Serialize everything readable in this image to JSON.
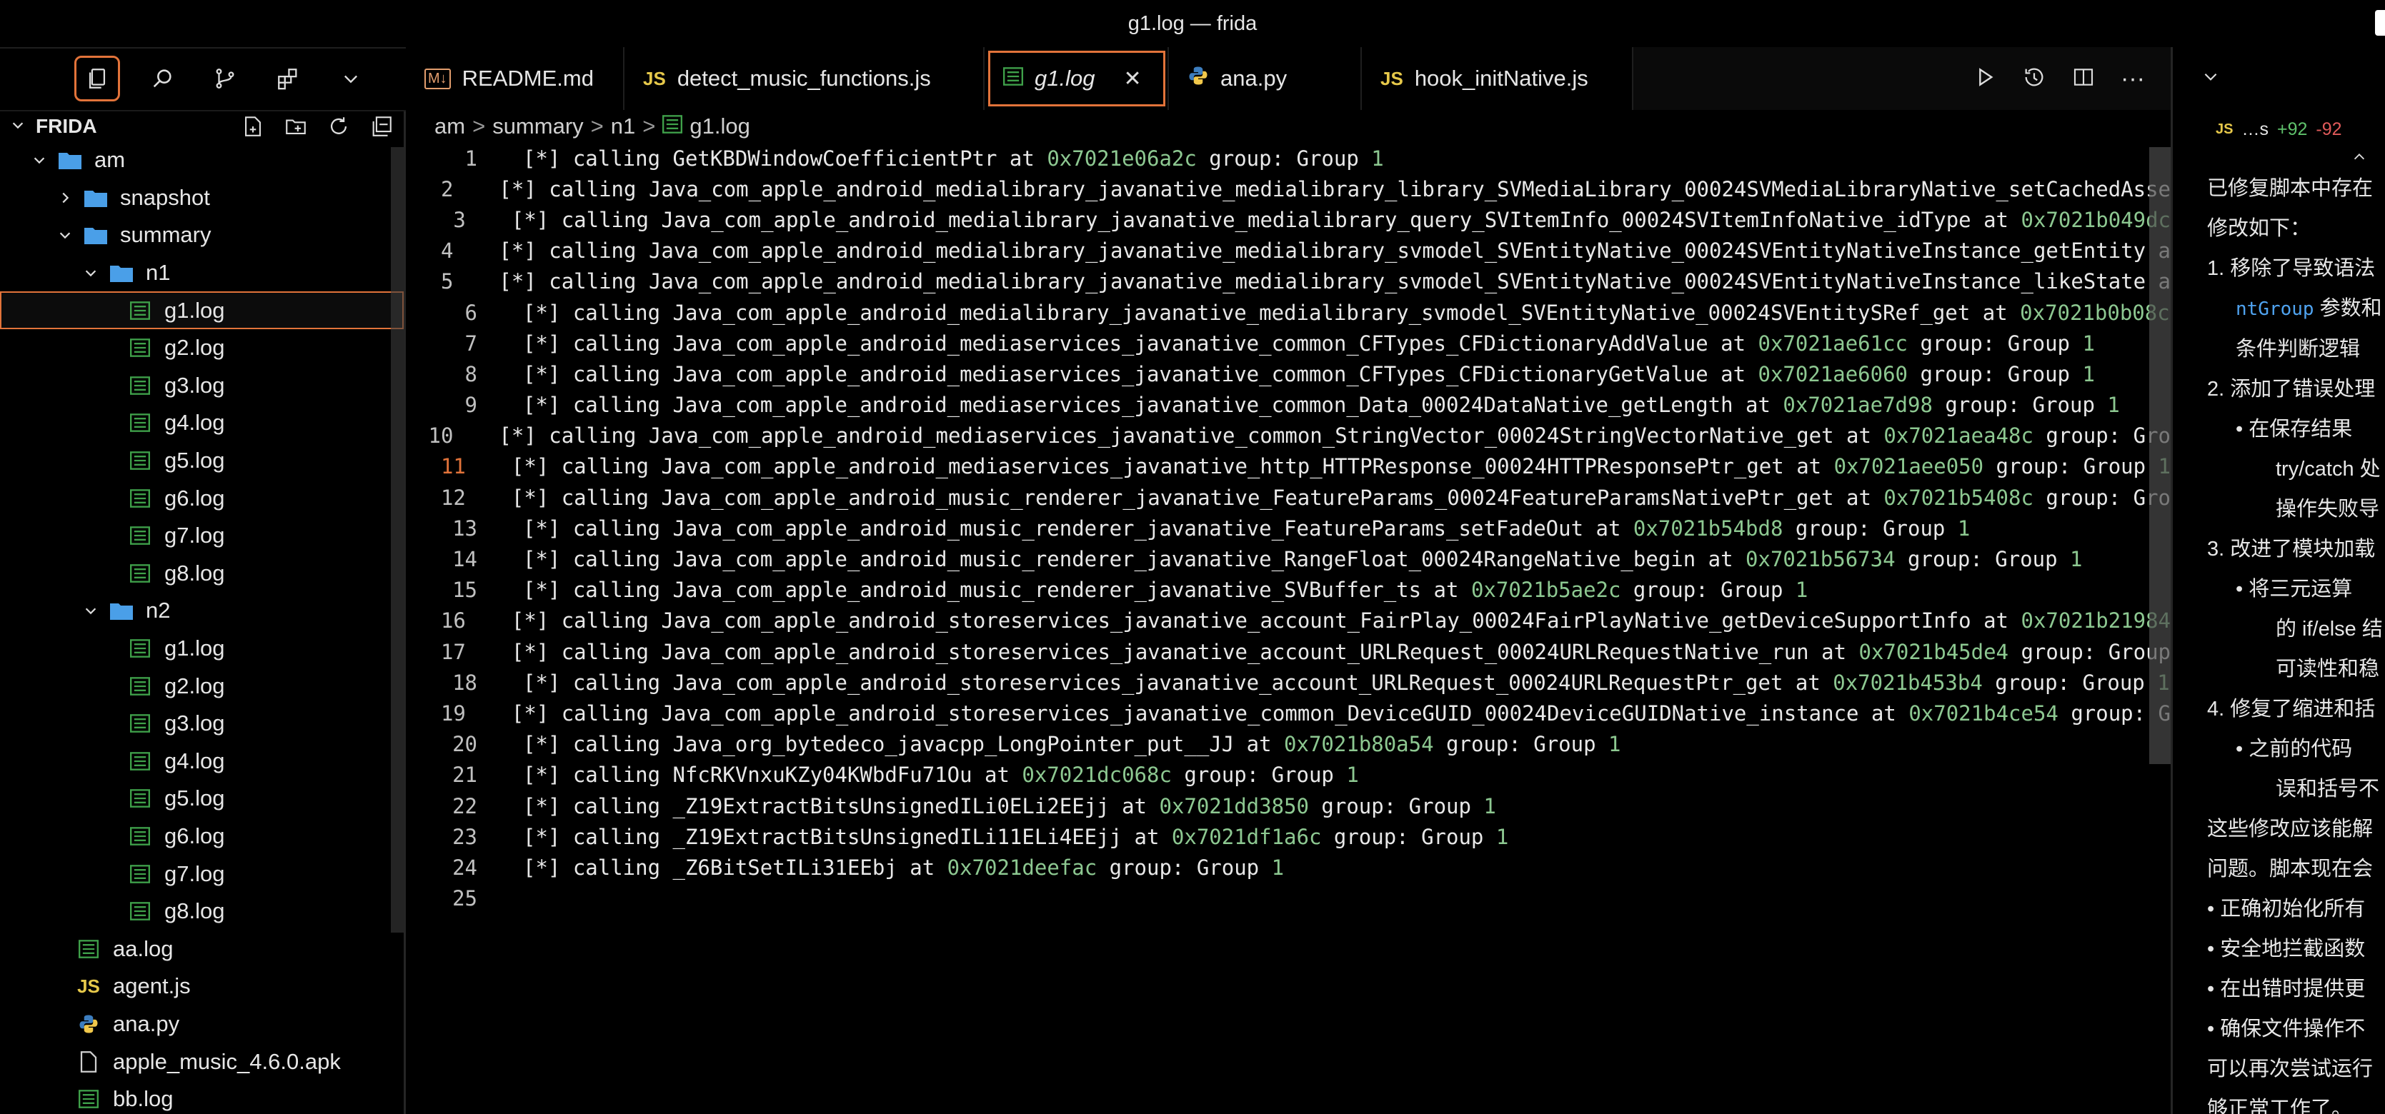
{
  "window": {
    "title": "g1.log — frida"
  },
  "sidebar": {
    "toolbar_icons": [
      "explorer-icon",
      "search-icon",
      "source-control-icon",
      "extensions-icon",
      "chevron-down-icon"
    ],
    "root_label": "FRIDA",
    "header_actions": [
      "new-file-icon",
      "new-folder-icon",
      "refresh-icon",
      "collapse-all-icon"
    ],
    "tree": [
      {
        "label": "am",
        "kind": "folder",
        "depth": 0,
        "open": true
      },
      {
        "label": "snapshot",
        "kind": "folder",
        "depth": 1,
        "open": false
      },
      {
        "label": "summary",
        "kind": "folder",
        "depth": 1,
        "open": true
      },
      {
        "label": "n1",
        "kind": "folder",
        "depth": 2,
        "open": true
      },
      {
        "label": "g1.log",
        "kind": "log",
        "depth": 3,
        "selected": true
      },
      {
        "label": "g2.log",
        "kind": "log",
        "depth": 3
      },
      {
        "label": "g3.log",
        "kind": "log",
        "depth": 3
      },
      {
        "label": "g4.log",
        "kind": "log",
        "depth": 3
      },
      {
        "label": "g5.log",
        "kind": "log",
        "depth": 3
      },
      {
        "label": "g6.log",
        "kind": "log",
        "depth": 3
      },
      {
        "label": "g7.log",
        "kind": "log",
        "depth": 3
      },
      {
        "label": "g8.log",
        "kind": "log",
        "depth": 3
      },
      {
        "label": "n2",
        "kind": "folder",
        "depth": 2,
        "open": true
      },
      {
        "label": "g1.log",
        "kind": "log",
        "depth": 3
      },
      {
        "label": "g2.log",
        "kind": "log",
        "depth": 3
      },
      {
        "label": "g3.log",
        "kind": "log",
        "depth": 3
      },
      {
        "label": "g4.log",
        "kind": "log",
        "depth": 3
      },
      {
        "label": "g5.log",
        "kind": "log",
        "depth": 3
      },
      {
        "label": "g6.log",
        "kind": "log",
        "depth": 3
      },
      {
        "label": "g7.log",
        "kind": "log",
        "depth": 3
      },
      {
        "label": "g8.log",
        "kind": "log",
        "depth": 3
      },
      {
        "label": "aa.log",
        "kind": "log",
        "depth": 1
      },
      {
        "label": "agent.js",
        "kind": "js",
        "depth": 1
      },
      {
        "label": "ana.py",
        "kind": "py",
        "depth": 1
      },
      {
        "label": "apple_music_4.6.0.apk",
        "kind": "file",
        "depth": 1
      },
      {
        "label": "bb.log",
        "kind": "log",
        "depth": 1
      }
    ]
  },
  "tabs": [
    {
      "label": "README.md",
      "kind": "md",
      "badge": "M↓"
    },
    {
      "label": "detect_music_functions.js",
      "kind": "js",
      "badge": "JS"
    },
    {
      "label": "g1.log",
      "kind": "log",
      "active": true,
      "close": "✕"
    },
    {
      "label": "ana.py",
      "kind": "py"
    },
    {
      "label": "hook_initNative.js",
      "kind": "js",
      "badge": "JS"
    }
  ],
  "breadcrumb": [
    "am",
    "summary",
    "n1",
    "g1.log"
  ],
  "breadcrumb_sep": ">",
  "editor": {
    "current_line": 11,
    "lines": [
      {
        "n": "1",
        "prefix": "[*] calling ",
        "fn": "GetKBDWindowCoefficientPtr",
        "at": " at ",
        "addr": "0x7021e06a2c",
        "group": " group: Group ",
        "g": "1"
      },
      {
        "n": "2",
        "prefix": "[*] calling ",
        "fn": "Java_com_apple_android_medialibrary_javanative_medialibrary_library_SVMediaLibrary_00024SVMediaLibraryNative_setCachedAsse",
        "at": "",
        "addr": "",
        "group": "",
        "g": ""
      },
      {
        "n": "3",
        "prefix": "[*] calling ",
        "fn": "Java_com_apple_android_medialibrary_javanative_medialibrary_query_SVItemInfo_00024SVItemInfoNative_idType",
        "at": " at ",
        "addr": "0x7021b049dc",
        "group": "",
        "g": ""
      },
      {
        "n": "4",
        "prefix": "[*] calling ",
        "fn": "Java_com_apple_android_medialibrary_javanative_medialibrary_svmodel_SVEntityNative_00024SVEntityNativeInstance_getEntity a",
        "at": "",
        "addr": "",
        "group": "",
        "g": ""
      },
      {
        "n": "5",
        "prefix": "[*] calling ",
        "fn": "Java_com_apple_android_medialibrary_javanative_medialibrary_svmodel_SVEntityNative_00024SVEntityNativeInstance_likeState a",
        "at": "",
        "addr": "",
        "group": "",
        "g": ""
      },
      {
        "n": "6",
        "prefix": "[*] calling ",
        "fn": "Java_com_apple_android_medialibrary_javanative_medialibrary_svmodel_SVEntityNative_00024SVEntitySRef_get",
        "at": " at ",
        "addr": "0x7021b0b08c",
        "group": "",
        "g": ""
      },
      {
        "n": "7",
        "prefix": "[*] calling ",
        "fn": "Java_com_apple_android_mediaservices_javanative_common_CFTypes_CFDictionaryAddValue",
        "at": " at ",
        "addr": "0x7021ae61cc",
        "group": " group: Group ",
        "g": "1"
      },
      {
        "n": "8",
        "prefix": "[*] calling ",
        "fn": "Java_com_apple_android_mediaservices_javanative_common_CFTypes_CFDictionaryGetValue",
        "at": " at ",
        "addr": "0x7021ae6060",
        "group": " group: Group ",
        "g": "1"
      },
      {
        "n": "9",
        "prefix": "[*] calling ",
        "fn": "Java_com_apple_android_mediaservices_javanative_common_Data_00024DataNative_getLength",
        "at": " at ",
        "addr": "0x7021ae7d98",
        "group": " group: Group ",
        "g": "1"
      },
      {
        "n": "10",
        "prefix": "[*] calling ",
        "fn": "Java_com_apple_android_mediaservices_javanative_common_StringVector_00024StringVectorNative_get",
        "at": " at ",
        "addr": "0x7021aea48c",
        "group": " group: Gro",
        "g": ""
      },
      {
        "n": "11",
        "prefix": "[*] calling ",
        "fn": "Java_com_apple_android_mediaservices_javanative_http_HTTPResponse_00024HTTPResponsePtr_get",
        "at": " at ",
        "addr": "0x7021aee050",
        "group": " group: Group ",
        "g": "1"
      },
      {
        "n": "12",
        "prefix": "[*] calling ",
        "fn": "Java_com_apple_android_music_renderer_javanative_FeatureParams_00024FeatureParamsNativePtr_get",
        "at": " at ",
        "addr": "0x7021b5408c",
        "group": " group: Gro",
        "g": ""
      },
      {
        "n": "13",
        "prefix": "[*] calling ",
        "fn": "Java_com_apple_android_music_renderer_javanative_FeatureParams_setFadeOut",
        "at": " at ",
        "addr": "0x7021b54bd8",
        "group": " group: Group ",
        "g": "1"
      },
      {
        "n": "14",
        "prefix": "[*] calling ",
        "fn": "Java_com_apple_android_music_renderer_javanative_RangeFloat_00024RangeNative_begin",
        "at": " at ",
        "addr": "0x7021b56734",
        "group": " group: Group ",
        "g": "1"
      },
      {
        "n": "15",
        "prefix": "[*] calling ",
        "fn": "Java_com_apple_android_music_renderer_javanative_SVBuffer_ts",
        "at": " at ",
        "addr": "0x7021b5ae2c",
        "group": " group: Group ",
        "g": "1"
      },
      {
        "n": "16",
        "prefix": "[*] calling ",
        "fn": "Java_com_apple_android_storeservices_javanative_account_FairPlay_00024FairPlayNative_getDeviceSupportInfo",
        "at": " at ",
        "addr": "0x7021b21984",
        "group": "",
        "g": ""
      },
      {
        "n": "17",
        "prefix": "[*] calling ",
        "fn": "Java_com_apple_android_storeservices_javanative_account_URLRequest_00024URLRequestNative_run",
        "at": " at ",
        "addr": "0x7021b45de4",
        "group": " group: Group",
        "g": ""
      },
      {
        "n": "18",
        "prefix": "[*] calling ",
        "fn": "Java_com_apple_android_storeservices_javanative_account_URLRequest_00024URLRequestPtr_get",
        "at": " at ",
        "addr": "0x7021b453b4",
        "group": " group: Group ",
        "g": "1"
      },
      {
        "n": "19",
        "prefix": "[*] calling ",
        "fn": "Java_com_apple_android_storeservices_javanative_common_DeviceGUID_00024DeviceGUIDNative_instance",
        "at": " at ",
        "addr": "0x7021b4ce54",
        "group": " group: G",
        "g": ""
      },
      {
        "n": "20",
        "prefix": "[*] calling ",
        "fn": "Java_org_bytedeco_javacpp_LongPointer_put__JJ",
        "at": " at ",
        "addr": "0x7021b80a54",
        "group": " group: Group ",
        "g": "1"
      },
      {
        "n": "21",
        "prefix": "[*] calling ",
        "fn": "NfcRKVnxuKZy04KWbdFu71Ou",
        "at": " at ",
        "addr": "0x7021dc068c",
        "group": " group: Group ",
        "g": "1"
      },
      {
        "n": "22",
        "prefix": "[*] calling ",
        "fn": "_Z19ExtractBitsUnsignedILi0ELi2EEjj",
        "at": " at ",
        "addr": "0x7021dd3850",
        "group": " group: Group ",
        "g": "1"
      },
      {
        "n": "23",
        "prefix": "[*] calling ",
        "fn": "_Z19ExtractBitsUnsignedILi11ELi4EEjj",
        "at": " at ",
        "addr": "0x7021df1a6c",
        "group": " group: Group ",
        "g": "1"
      },
      {
        "n": "24",
        "prefix": "[*] calling ",
        "fn": "_Z6BitSetILi31EEbj",
        "at": " at ",
        "addr": "0x7021deefac",
        "group": " group: Group ",
        "g": "1"
      },
      {
        "n": "25",
        "prefix": "",
        "fn": "",
        "at": "",
        "addr": "",
        "group": "",
        "g": ""
      }
    ]
  },
  "right_panel": {
    "file_badge": "JS",
    "file_name": "…s",
    "added": "+92",
    "removed": "-92",
    "lines": [
      {
        "text": "已修复脚本中存在",
        "cls": ""
      },
      {
        "text": "修改如下：",
        "cls": ""
      },
      {
        "text": "1. 移除了导致语法",
        "cls": ""
      },
      {
        "text": "ntGroup 参数和",
        "cls": "sub",
        "code": "ntGroup"
      },
      {
        "text": "条件判断逻辑",
        "cls": "sub"
      },
      {
        "text": "2. 添加了错误处理",
        "cls": ""
      },
      {
        "text": "• 在保存结果",
        "cls": "sub"
      },
      {
        "text": "try/catch 处",
        "cls": "sub2"
      },
      {
        "text": "操作失败导",
        "cls": "sub2"
      },
      {
        "text": "3. 改进了模块加载",
        "cls": ""
      },
      {
        "text": "• 将三元运算",
        "cls": "sub"
      },
      {
        "text": "的 if/else 结",
        "cls": "sub2"
      },
      {
        "text": "可读性和稳",
        "cls": "sub2"
      },
      {
        "text": "4. 修复了缩进和括",
        "cls": ""
      },
      {
        "text": "• 之前的代码",
        "cls": "sub"
      },
      {
        "text": "误和括号不",
        "cls": "sub2"
      },
      {
        "text": "这些修改应该能解",
        "cls": ""
      },
      {
        "text": "问题。脚本现在会",
        "cls": ""
      },
      {
        "text": "• 正确初始化所有",
        "cls": ""
      },
      {
        "text": "• 安全地拦截函数",
        "cls": ""
      },
      {
        "text": "• 在出错时提供更",
        "cls": ""
      },
      {
        "text": "• 确保文件操作不",
        "cls": ""
      },
      {
        "text": "可以再次尝试运行",
        "cls": ""
      },
      {
        "text": "够正常工作了。",
        "cls": ""
      }
    ]
  },
  "colors": {
    "accent": "#e2733a",
    "address": "#8dc891",
    "folder": "#4a9fe8",
    "log_icon": "#3fa14a"
  }
}
